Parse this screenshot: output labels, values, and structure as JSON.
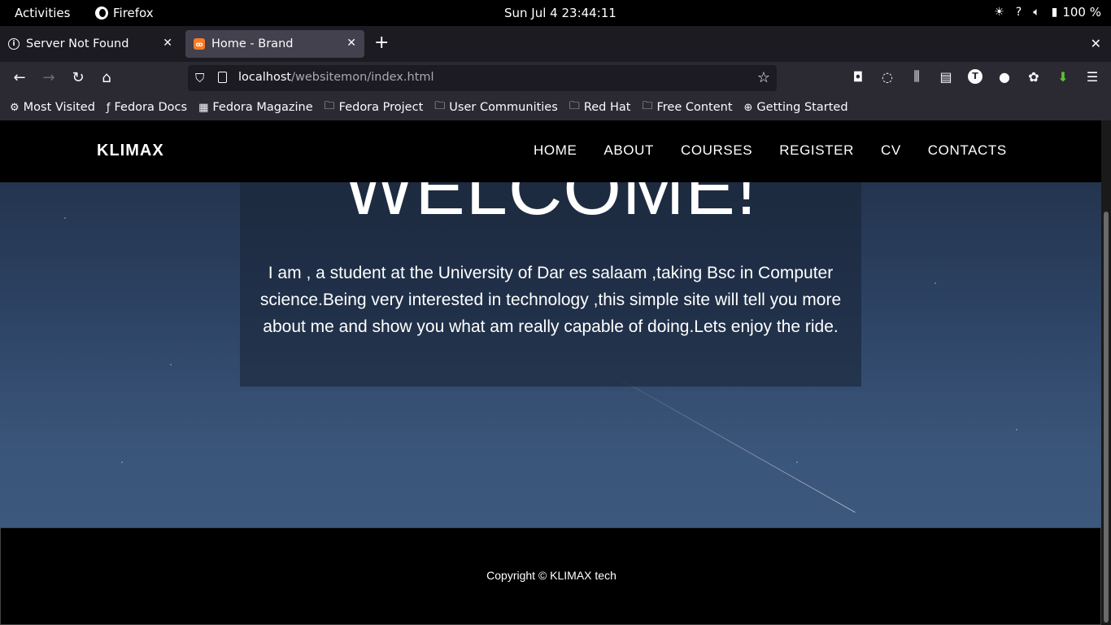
{
  "topbar": {
    "activities": "Activities",
    "app_name": "Firefox",
    "clock": "Sun Jul 4  23:44:11",
    "battery": "100 %"
  },
  "tabs": [
    {
      "label": "Server Not Found",
      "icon": "info-icon"
    },
    {
      "label": "Home - Brand",
      "icon": "xampp-icon"
    }
  ],
  "urlbar": {
    "host": "localhost",
    "path": "/websitemon/index.html"
  },
  "bookmarks": [
    {
      "label": "Most Visited",
      "icon": "gear-icon"
    },
    {
      "label": "Fedora Docs",
      "icon": "fedora-icon"
    },
    {
      "label": "Fedora Magazine",
      "icon": "fm-icon"
    },
    {
      "label": "Fedora Project",
      "icon": "folder-icon"
    },
    {
      "label": "User Communities",
      "icon": "folder-icon"
    },
    {
      "label": "Red Hat",
      "icon": "folder-icon"
    },
    {
      "label": "Free Content",
      "icon": "folder-icon"
    },
    {
      "label": "Getting Started",
      "icon": "globe-icon"
    }
  ],
  "site": {
    "brand": "KLIMAX",
    "nav": [
      "HOME",
      "ABOUT",
      "COURSES",
      "REGISTER",
      "CV",
      "CONTACTS"
    ],
    "welcome_title": "WELCOME!",
    "welcome_text": "I am , a student at the University of Dar es salaam ,taking Bsc in Computer science.Being very interested in technology ,this simple site will tell you more about me and show you what am really capable of doing.Lets enjoy the ride.",
    "copyright": "Copyright © KLIMAX tech"
  },
  "colors": {
    "header_bg": "#000000",
    "tab_active": "#42414d",
    "toolbar_bg": "#2b2a33",
    "sky": "#2c4263"
  }
}
